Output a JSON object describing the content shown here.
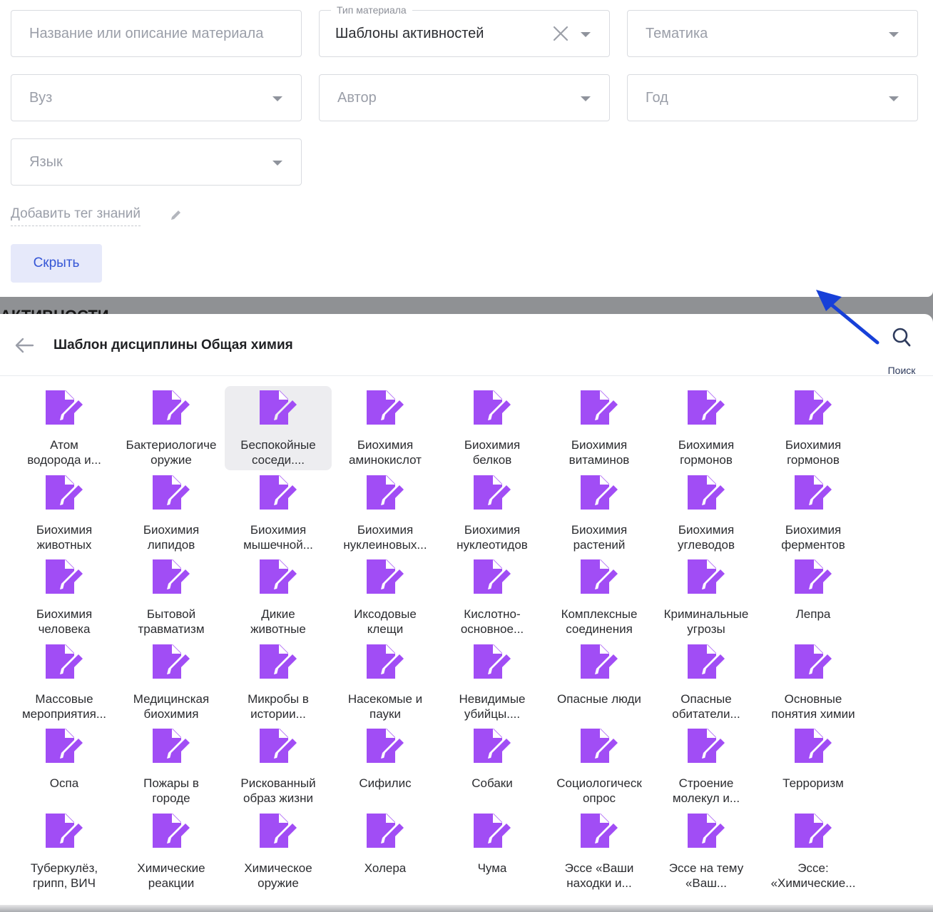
{
  "filters": {
    "search_placeholder": "Название или описание материала",
    "material_type_legend": "Тип материала",
    "material_type_value": "Шаблоны активностей",
    "topic_placeholder": "Тематика",
    "university_placeholder": "Вуз",
    "author_placeholder": "Автор",
    "year_placeholder": "Год",
    "language_placeholder": "Язык",
    "add_tag_label": "Добавить тег знаний",
    "hide_button": "Скрыть"
  },
  "background_heading": "АКТИВНОСТИ",
  "drawer": {
    "title": "Шаблон дисциплины Общая химия",
    "search_label": "Поиск"
  },
  "colors": {
    "accent": "#3556d6",
    "icon_purple": "#a14df5",
    "arrow_blue": "#1740d8"
  },
  "items": [
    {
      "line1": "Атом",
      "line2": "водорода и..."
    },
    {
      "line1": "Бактериологиче",
      "line2": "оружие"
    },
    {
      "line1": "Беспокойные",
      "line2": "соседи...."
    },
    {
      "line1": "Биохимия",
      "line2": "аминокислот"
    },
    {
      "line1": "Биохимия",
      "line2": "белков"
    },
    {
      "line1": "Биохимия",
      "line2": "витаминов"
    },
    {
      "line1": "Биохимия",
      "line2": "гормонов"
    },
    {
      "line1": "Биохимия",
      "line2": "гормонов"
    },
    {
      "line1": "Биохимия",
      "line2": "животных"
    },
    {
      "line1": "Биохимия",
      "line2": "липидов"
    },
    {
      "line1": "Биохимия",
      "line2": "мышечной..."
    },
    {
      "line1": "Биохимия",
      "line2": "нуклеиновых..."
    },
    {
      "line1": "Биохимия",
      "line2": "нуклеотидов"
    },
    {
      "line1": "Биохимия",
      "line2": "растений"
    },
    {
      "line1": "Биохимия",
      "line2": "углеводов"
    },
    {
      "line1": "Биохимия",
      "line2": "ферментов"
    },
    {
      "line1": "Биохимия",
      "line2": "человека"
    },
    {
      "line1": "Бытовой",
      "line2": "травматизм"
    },
    {
      "line1": "Дикие",
      "line2": "животные"
    },
    {
      "line1": "Иксодовые",
      "line2": "клещи"
    },
    {
      "line1": "Кислотно-",
      "line2": "основное..."
    },
    {
      "line1": "Комплексные",
      "line2": "соединения"
    },
    {
      "line1": "Криминальные",
      "line2": "угрозы"
    },
    {
      "line1": "Лепра",
      "line2": ""
    },
    {
      "line1": "Массовые",
      "line2": "мероприятия..."
    },
    {
      "line1": "Медицинская",
      "line2": "биохимия"
    },
    {
      "line1": "Микробы в",
      "line2": "истории..."
    },
    {
      "line1": "Насекомые и",
      "line2": "пауки"
    },
    {
      "line1": "Невидимые",
      "line2": "убийцы...."
    },
    {
      "line1": "Опасные люди",
      "line2": ""
    },
    {
      "line1": "Опасные",
      "line2": "обитатели..."
    },
    {
      "line1": "Основные",
      "line2": "понятия химии"
    },
    {
      "line1": "Оспа",
      "line2": ""
    },
    {
      "line1": "Пожары в",
      "line2": "городе"
    },
    {
      "line1": "Рискованный",
      "line2": "образ жизни"
    },
    {
      "line1": "Сифилис",
      "line2": ""
    },
    {
      "line1": "Собаки",
      "line2": ""
    },
    {
      "line1": "Социологическ",
      "line2": "опрос"
    },
    {
      "line1": "Строение",
      "line2": "молекул и..."
    },
    {
      "line1": "Терроризм",
      "line2": ""
    },
    {
      "line1": "Туберкулёз,",
      "line2": "грипп, ВИЧ"
    },
    {
      "line1": "Химические",
      "line2": "реакции"
    },
    {
      "line1": "Химическое",
      "line2": "оружие"
    },
    {
      "line1": "Холера",
      "line2": ""
    },
    {
      "line1": "Чума",
      "line2": ""
    },
    {
      "line1": "Эссе «Ваши",
      "line2": "находки и..."
    },
    {
      "line1": "Эссе на тему",
      "line2": "«Ваш..."
    },
    {
      "line1": "Эссе:",
      "line2": "«Химические..."
    }
  ]
}
